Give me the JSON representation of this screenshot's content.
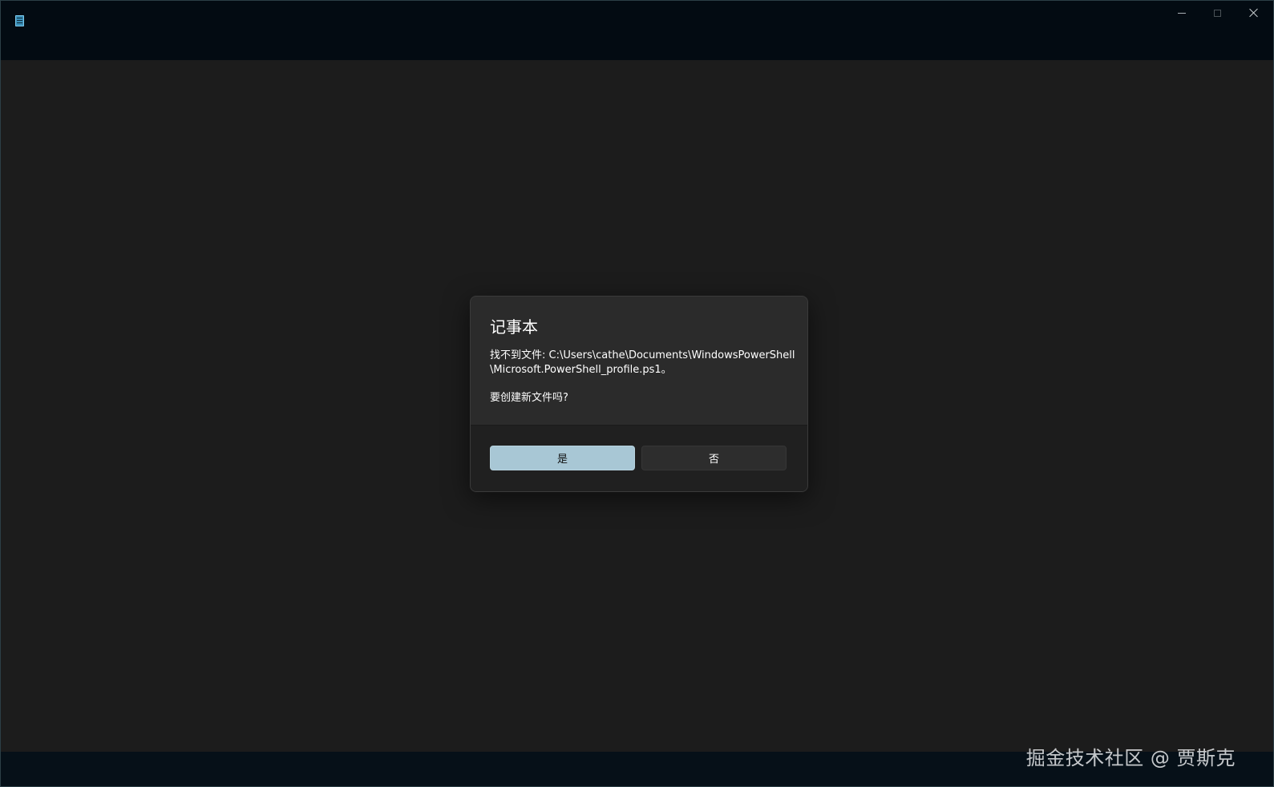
{
  "window": {
    "icon": "notepad-icon",
    "controls": [
      "minimize-icon",
      "maximize-icon",
      "close-icon"
    ]
  },
  "dialog": {
    "title": "记事本",
    "message_line1": "找不到文件: C:\\Users\\cathe\\Documents\\WindowsPowerShell",
    "message_line2": "\\Microsoft.PowerShell_profile.ps1。",
    "question": "要创建新文件吗?",
    "yes_label": "是",
    "no_label": "否"
  },
  "watermark": "掘金技术社区 @ 贾斯克",
  "colors": {
    "titlebar": "#030b12",
    "background": "#1c1c1c",
    "dialog": "#2b2b2b",
    "accent_button": "#a8c7d5"
  }
}
